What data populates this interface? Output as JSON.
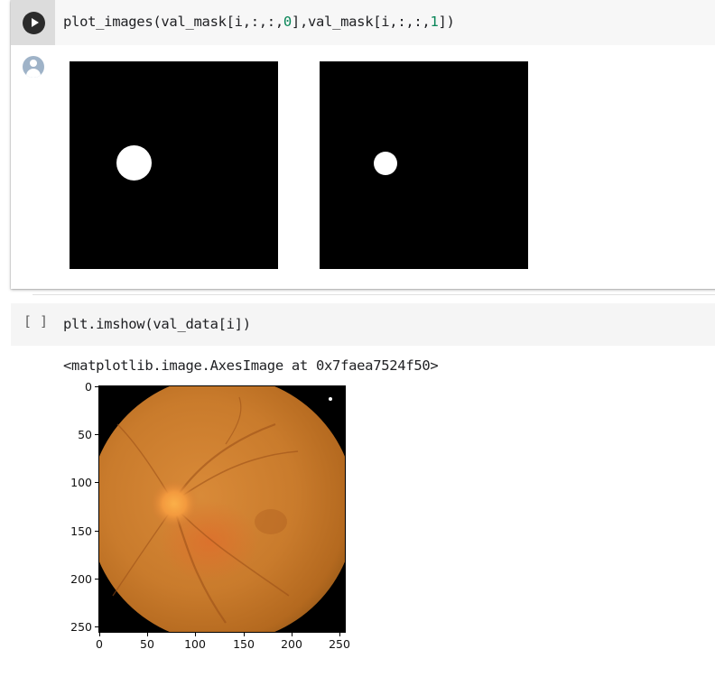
{
  "cells": [
    {
      "code_parts": {
        "a": "plot_images(val_mask[i,:,:,",
        "n0": "0",
        "b": "],val_mask[i,:,:,",
        "n1": "1",
        "c": "])"
      },
      "output_images": [
        {
          "name": "mask-channel-0",
          "background": "#000000",
          "blob_color": "#ffffff"
        },
        {
          "name": "mask-channel-1",
          "background": "#000000",
          "blob_color": "#ffffff"
        }
      ]
    },
    {
      "prompt": "[ ]",
      "code": "plt.imshow(val_data[i])",
      "output_text": "<matplotlib.image.AxesImage at 0x7faea7524f50>",
      "plot": {
        "y_ticks": [
          "0",
          "50",
          "100",
          "150",
          "200",
          "250"
        ],
        "x_ticks": [
          "0",
          "50",
          "100",
          "150",
          "200",
          "250"
        ]
      }
    }
  ],
  "colors": {
    "run_button": "#2b2b2b",
    "input_background": "#f7f7f7",
    "number_literal": "#098658"
  }
}
